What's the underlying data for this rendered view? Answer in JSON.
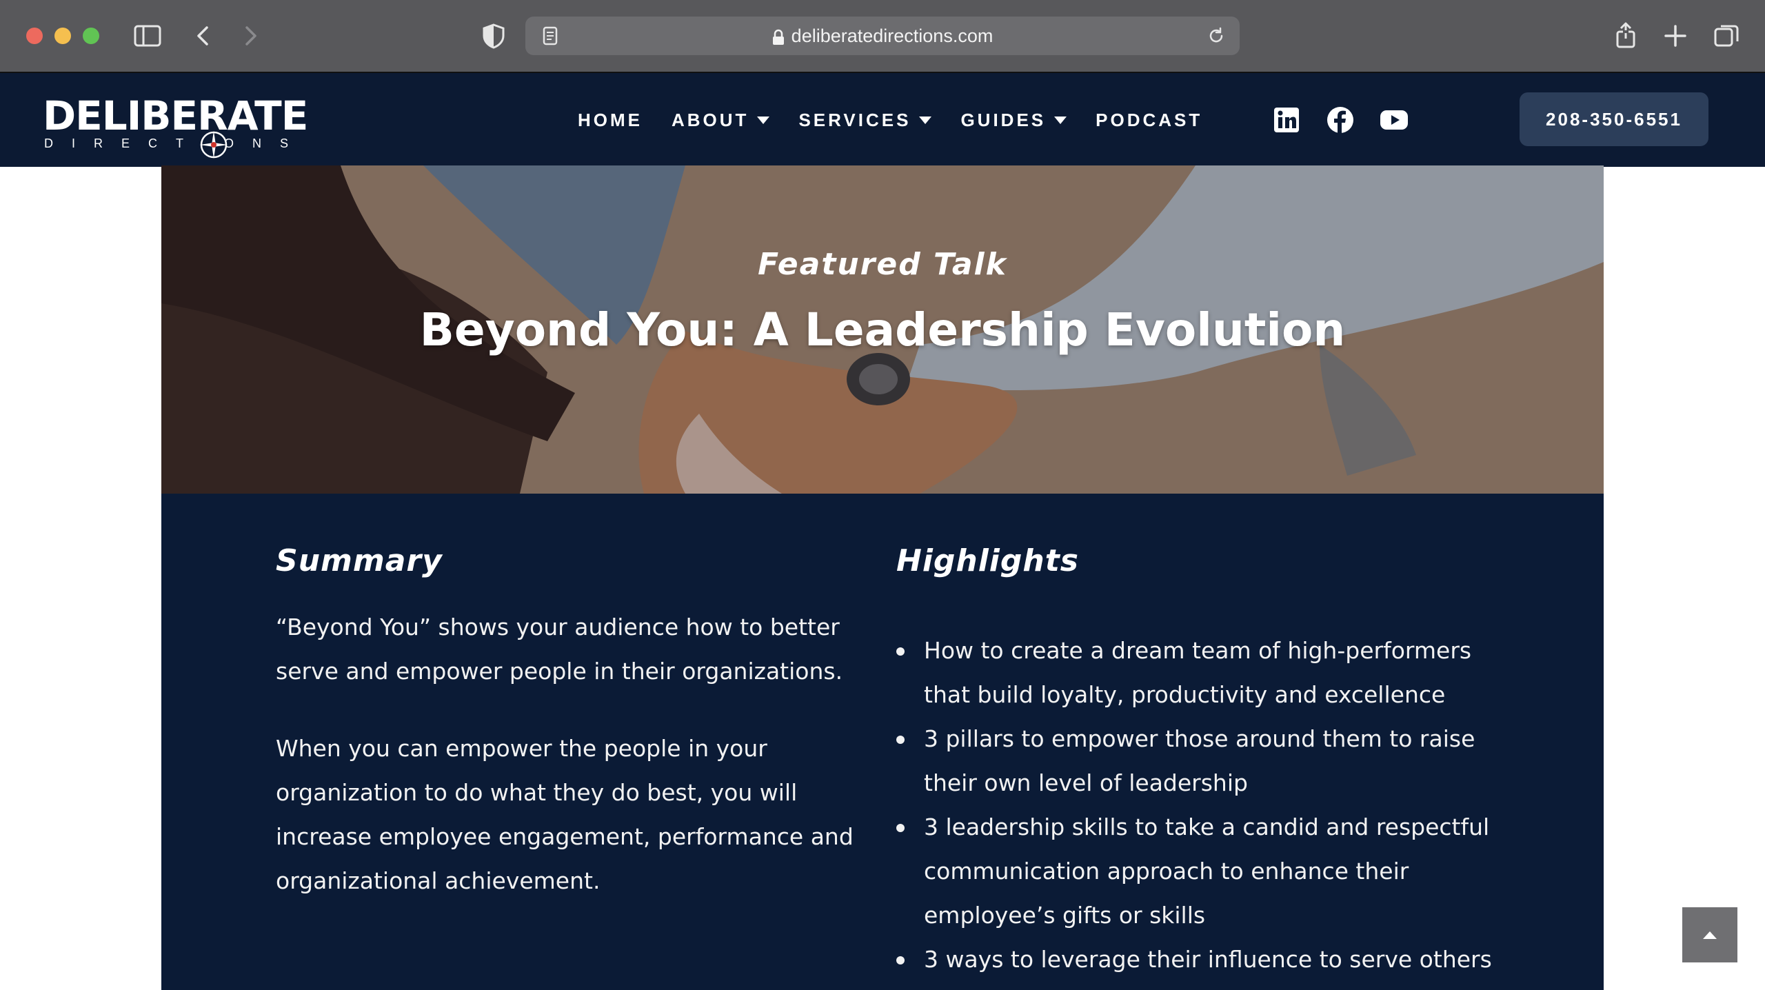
{
  "browser": {
    "url": "deliberatedirections.com"
  },
  "site": {
    "logo": {
      "word": "DELIBERATE",
      "sub": "DIRECTIONS"
    },
    "nav": [
      {
        "label": "HOME"
      },
      {
        "label": "ABOUT"
      },
      {
        "label": "SERVICES"
      },
      {
        "label": "GUIDES"
      },
      {
        "label": "PODCAST"
      }
    ],
    "social": [
      "linkedin-icon",
      "facebook-icon",
      "youtube-icon"
    ],
    "phone": "208-350-6551"
  },
  "hero": {
    "kicker": "Featured Talk",
    "title": "Beyond You: A Leadership Evolution"
  },
  "summary": {
    "title": "Summary",
    "paragraphs": [
      "“Beyond You” shows your audience how to better serve and empower people in their organizations.",
      "When you can empower the people in your organization to do what they do best, you will increase employee engagement, performance and organizational achievement."
    ]
  },
  "highlights": {
    "title": "Highlights",
    "items": [
      "How to create a dream team of high-performers that build loyalty, productivity and excellence",
      "3 pillars to empower those around them to raise their own level of leadership",
      "3 leadership skills to take a candid and respectful communication approach to enhance their employee’s gifts or skills",
      "3 ways to leverage their influence to serve others"
    ]
  },
  "colors": {
    "header_bg": "#0c1a33",
    "content_bg": "#0b1b36",
    "phone_button_bg": "#2c3e5a"
  }
}
